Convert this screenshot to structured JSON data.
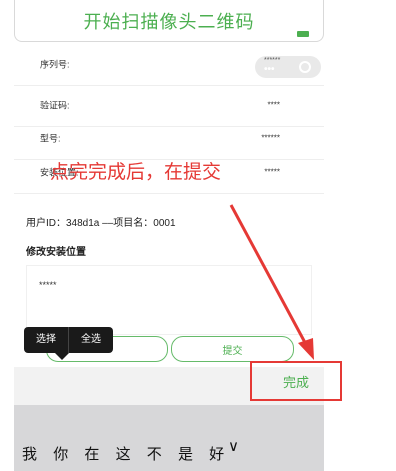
{
  "scan": {
    "label": "开始扫描像头二维码"
  },
  "fields": [
    {
      "label": "序列号:",
      "value": "******"
    },
    {
      "label": "验证码:",
      "value": "****"
    },
    {
      "label": "型号:",
      "value": "******"
    },
    {
      "label": "安装位置:",
      "value": "*****"
    }
  ],
  "annotation": "点完完成后，在提交",
  "info": "用户ID：348d1a ––项目名：0001",
  "modify": {
    "label": "修改安装位置",
    "value": "*****"
  },
  "buttons": {
    "submit": "提交",
    "done": "完成"
  },
  "context_menu": {
    "select": "选择",
    "select_all": "全选"
  },
  "keyboard": {
    "candidates": [
      "我",
      "你",
      "在",
      "这",
      "不",
      "是",
      "好"
    ],
    "expand": "∨"
  },
  "colors": {
    "accent": "#4caf50",
    "annotation": "#e53935"
  }
}
